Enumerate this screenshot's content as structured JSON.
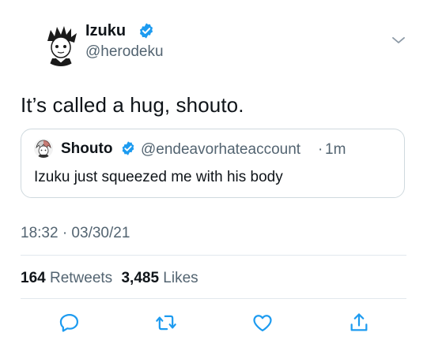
{
  "author": {
    "name": "Izuku",
    "handle": "@herodeku"
  },
  "tweet": {
    "text": "It’s called a hug, shouto.",
    "timestamp": "18:32 · 03/30/21"
  },
  "quoted": {
    "name": "Shouto",
    "handle": "@endeavorhateaccount",
    "separator": "·",
    "time": "1m",
    "text": "Izuku just squeezed me with his body"
  },
  "stats": {
    "retweets_count": "164",
    "retweets_label": "Retweets",
    "likes_count": "3,485",
    "likes_label": "Likes"
  },
  "colors": {
    "verified": "#1d9bf0",
    "secondary_text": "#536471",
    "icon": "#1d9bf0"
  },
  "icons": {
    "reply": "reply-icon",
    "retweet": "retweet-icon",
    "like": "like-icon",
    "share": "share-icon"
  }
}
